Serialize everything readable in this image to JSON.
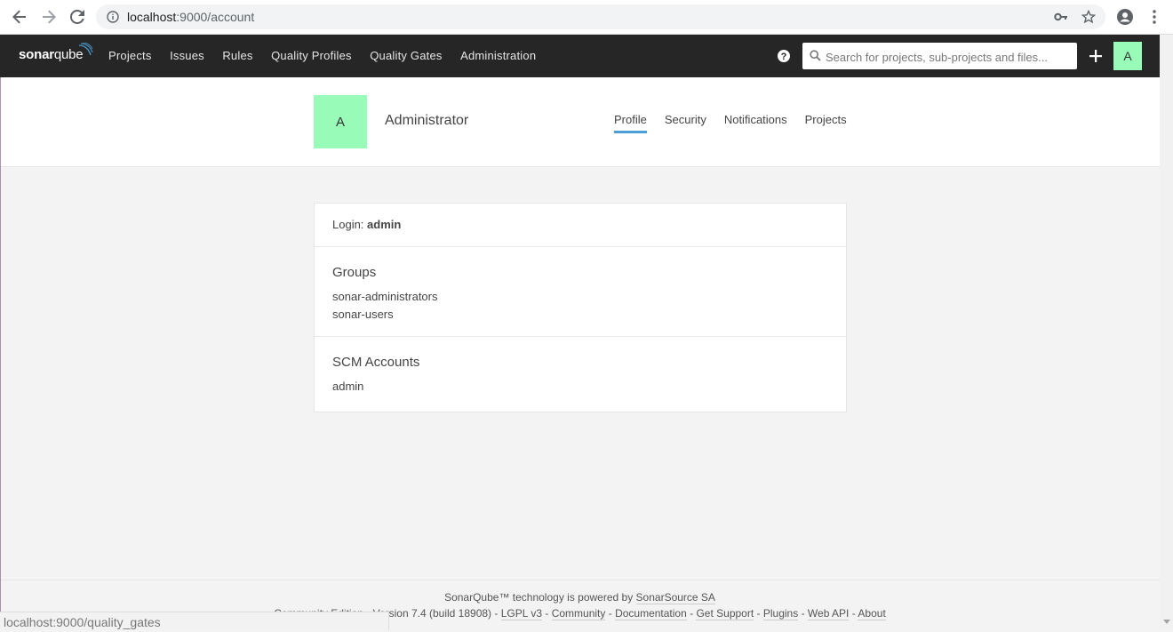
{
  "browser": {
    "url_host": "localhost",
    "url_path": ":9000/account",
    "status_url": "localhost:9000/quality_gates"
  },
  "navbar": {
    "logo_bold": "sonar",
    "logo_light": "qube",
    "menu": [
      "Projects",
      "Issues",
      "Rules",
      "Quality Profiles",
      "Quality Gates",
      "Administration"
    ],
    "search_placeholder": "Search for projects, sub-projects and files...",
    "avatar_letter": "A"
  },
  "account": {
    "avatar_letter": "A",
    "name": "Administrator",
    "tabs": [
      "Profile",
      "Security",
      "Notifications",
      "Projects"
    ],
    "active_tab": "Profile"
  },
  "profile": {
    "login_label": "Login:",
    "login_value": "admin",
    "groups_title": "Groups",
    "groups": [
      "sonar-administrators",
      "sonar-users"
    ],
    "scm_title": "SCM Accounts",
    "scm_accounts": [
      "admin"
    ]
  },
  "footer": {
    "powered_text": "SonarQube™ technology is powered by",
    "powered_link": "SonarSource SA",
    "edition": "Community Edition",
    "version": "Version 7.4 (build 18908)",
    "links": [
      "LGPL v3",
      "Community",
      "Documentation",
      "Get Support",
      "Plugins",
      "Web API",
      "About"
    ]
  },
  "colors": {
    "navbar_bg": "#262626",
    "avatar_bg": "#98fbb8",
    "active_tab_underline": "#4b9fd5"
  }
}
